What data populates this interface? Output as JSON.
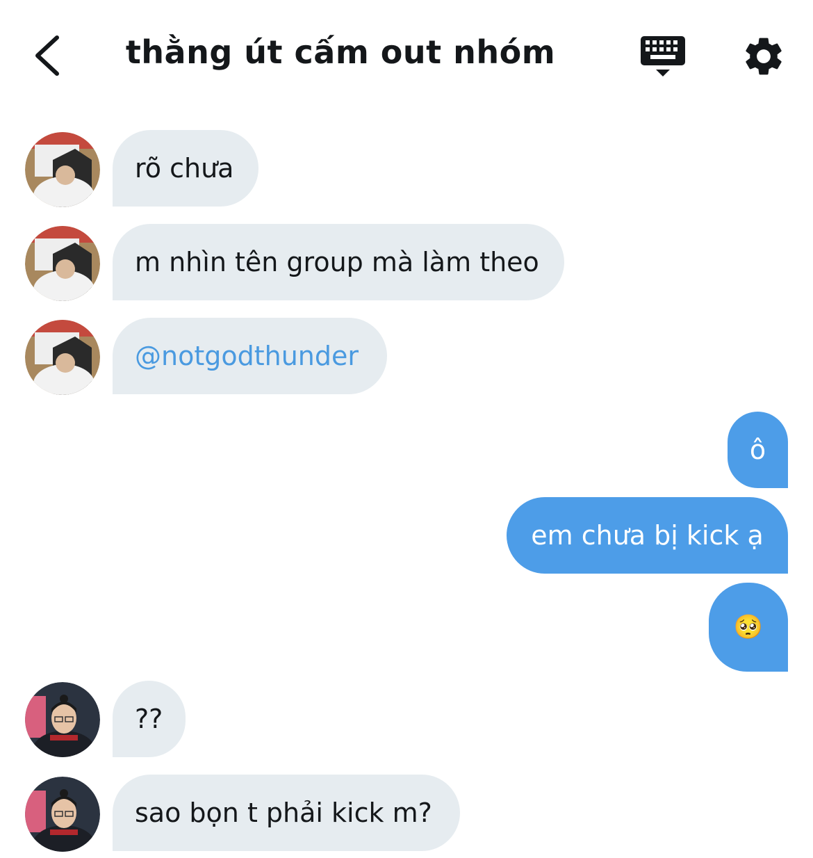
{
  "header": {
    "title": "thằng út cấm out nhóm",
    "back_icon": "chevron-left-icon",
    "keyboard_icon": "keyboard-hide-icon",
    "settings_icon": "gear-icon"
  },
  "messages": [
    {
      "side": "in",
      "text": "rõ chưa",
      "avatar": "avatar-user-a"
    },
    {
      "side": "in",
      "text": "m nhìn tên group mà làm theo",
      "avatar": "avatar-user-a"
    },
    {
      "side": "in",
      "text": "@notgodthunder",
      "avatar": "avatar-user-a",
      "is_mention": true
    },
    {
      "side": "out",
      "text": "ô"
    },
    {
      "side": "out",
      "text": "em chưa bị kick ạ"
    },
    {
      "side": "out",
      "text": "🥺"
    },
    {
      "side": "in",
      "text": "??",
      "avatar": "avatar-user-b"
    },
    {
      "side": "in",
      "text": "sao bọn t phải kick m?",
      "avatar": "avatar-user-b"
    }
  ],
  "colors": {
    "incoming_bubble": "#e6ecf0",
    "outgoing_bubble": "#4d9de8",
    "mention": "#4a9ae0",
    "title": "#14171a"
  }
}
